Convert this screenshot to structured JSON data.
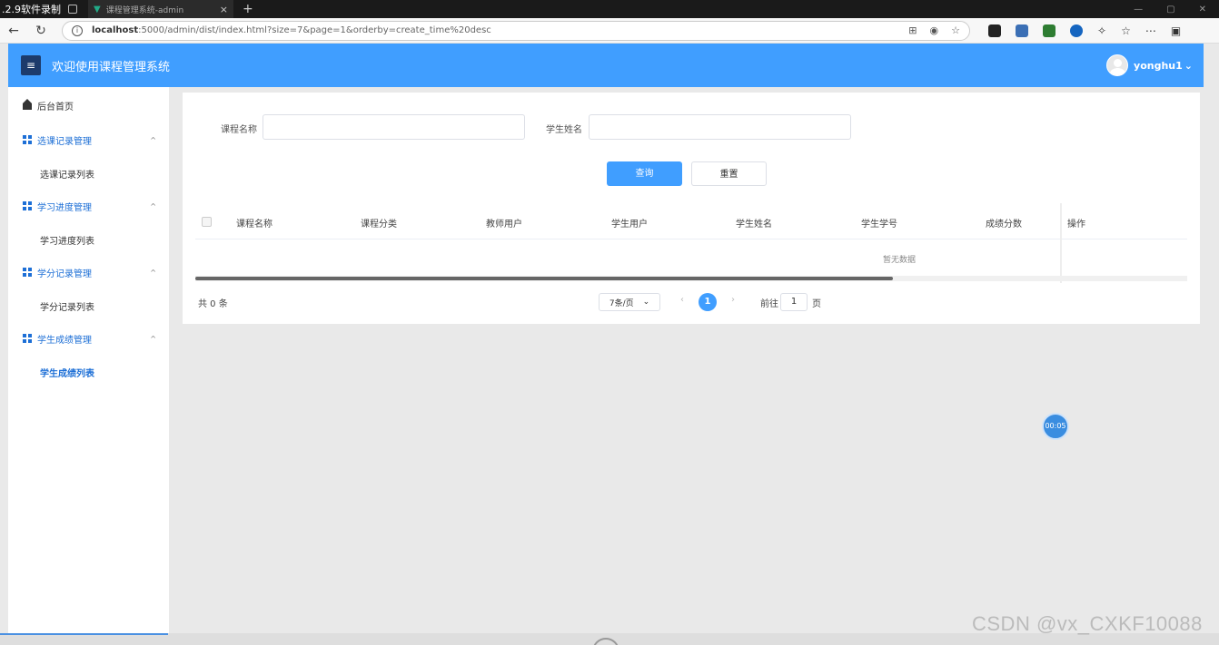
{
  "recorder": {
    "title": ".2.9软件录制"
  },
  "browser": {
    "tab_title": "课程管理系统-admin",
    "new_tab": "+",
    "url_host": "localhost",
    "url_rest": ":5000/admin/dist/index.html?size=7&page=1&orderby=create_time%20desc"
  },
  "header": {
    "menu_icon": "≡",
    "title": "欢迎使用课程管理系统",
    "username": "yonghu1",
    "caret": "⌄"
  },
  "sidebar": {
    "home": "后台首页",
    "groups": [
      {
        "label": "选课记录管理",
        "child": "选课记录列表"
      },
      {
        "label": "学习进度管理",
        "child": "学习进度列表"
      },
      {
        "label": "学分记录管理",
        "child": "学分记录列表"
      },
      {
        "label": "学生成绩管理",
        "child": "学生成绩列表"
      }
    ]
  },
  "search": {
    "course_name_label": "课程名称",
    "student_name_label": "学生姓名",
    "query_button": "查询",
    "reset_button": "重置"
  },
  "table": {
    "columns": [
      "课程名称",
      "课程分类",
      "教师用户",
      "学生用户",
      "学生姓名",
      "学生学号",
      "成绩分数",
      "操作"
    ],
    "empty_text": "暂无数据"
  },
  "pagination": {
    "total": "共 0 条",
    "page_size": "7条/页",
    "prev": "‹",
    "next": "›",
    "current": "1",
    "goto_label": "前往",
    "goto_value": "1",
    "goto_suffix": "页"
  },
  "timer": "00:05",
  "watermark": "CSDN @vx_CXKF10088",
  "colors": {
    "primary": "#409eff",
    "menu_button": "#1d3b6b",
    "active_text": "#1d6fd6"
  }
}
